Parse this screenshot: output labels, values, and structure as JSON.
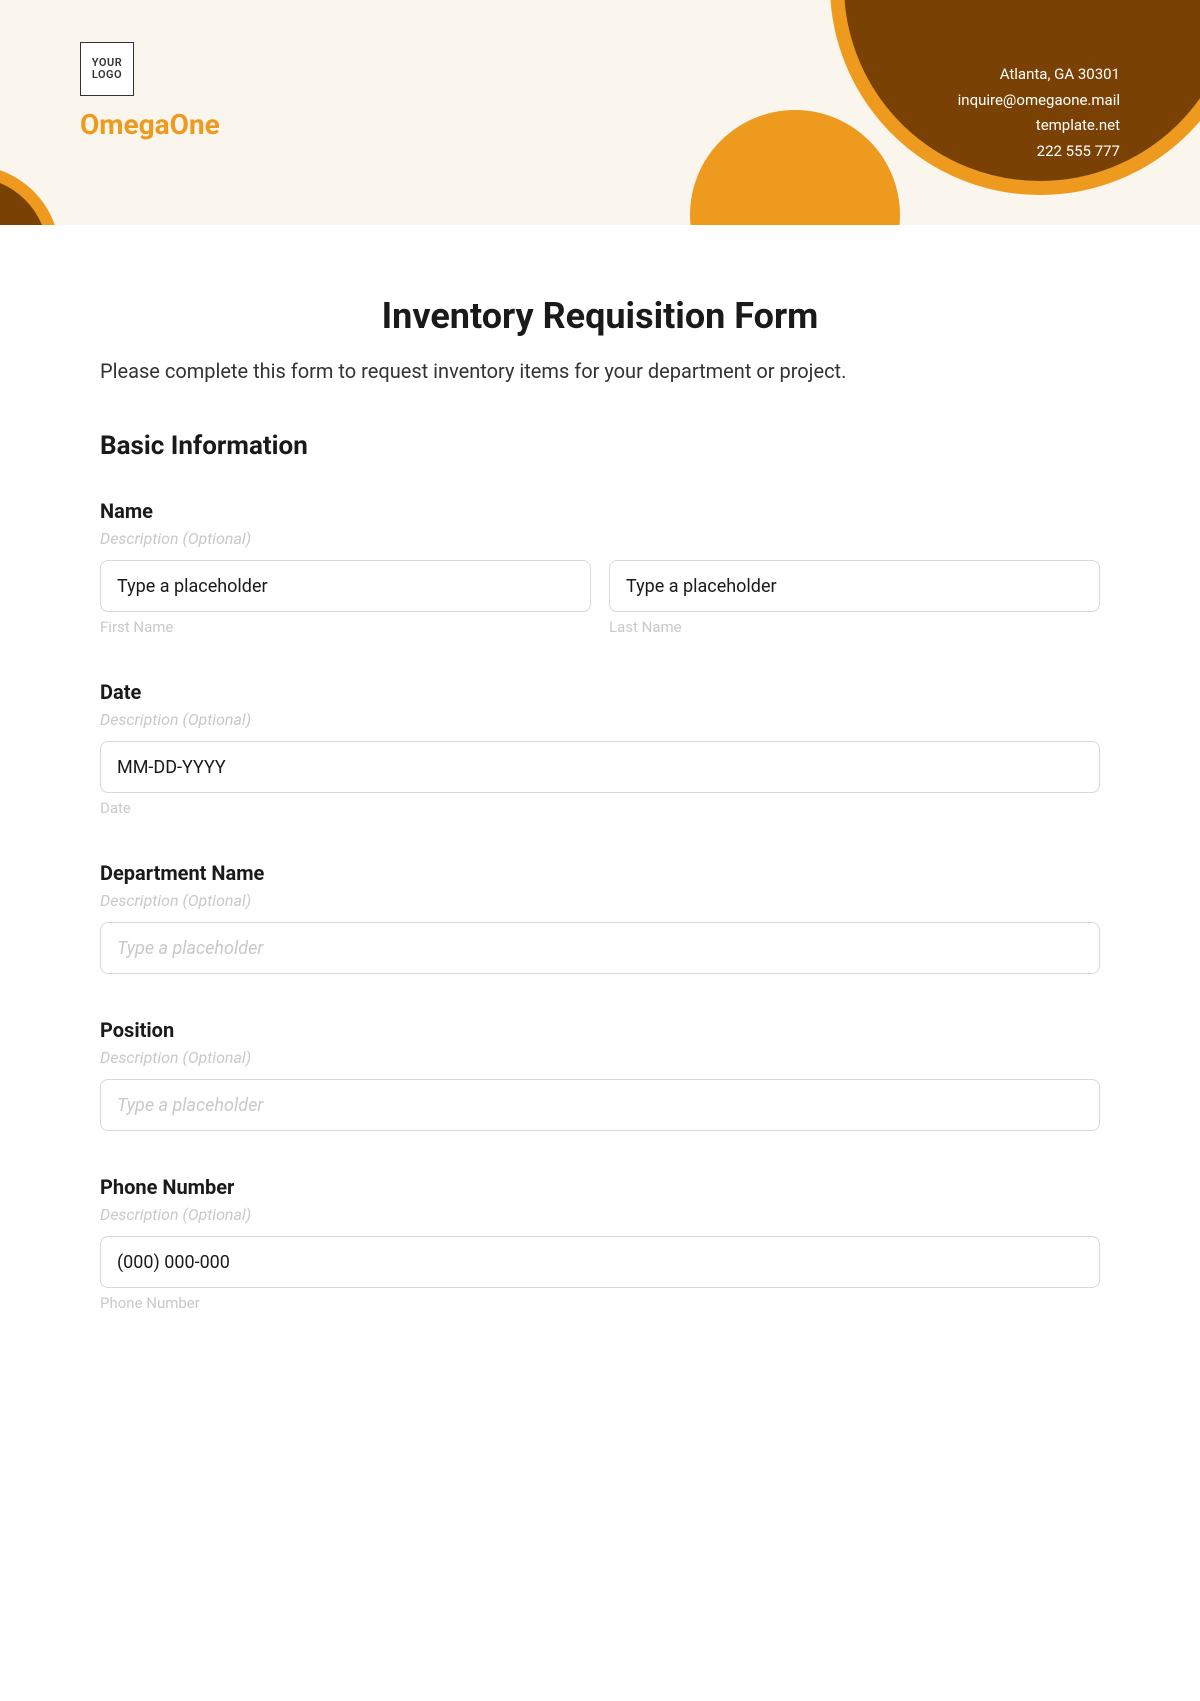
{
  "header": {
    "logo_text": "YOUR\nLOGO",
    "brand": "OmegaOne",
    "contact": {
      "address": "Atlanta, GA 30301",
      "email": "inquire@omegaone.mail",
      "website": "template.net",
      "phone": "222 555 777"
    }
  },
  "form": {
    "title": "Inventory Requisition Form",
    "subtitle": "Please complete this form to request inventory items for your department or project.",
    "section_heading": "Basic Information",
    "fields": {
      "name": {
        "label": "Name",
        "desc": "Description (Optional)",
        "first_value": "Type a placeholder",
        "first_sub": "First Name",
        "last_value": "Type a placeholder",
        "last_sub": "Last Name"
      },
      "date": {
        "label": "Date",
        "desc": "Description (Optional)",
        "value": "MM-DD-YYYY",
        "sub": "Date"
      },
      "department": {
        "label": "Department Name",
        "desc": "Description (Optional)",
        "placeholder": "Type a placeholder"
      },
      "position": {
        "label": "Position",
        "desc": "Description (Optional)",
        "placeholder": "Type a placeholder"
      },
      "phone": {
        "label": "Phone Number",
        "desc": "Description (Optional)",
        "value": "(000) 000-000",
        "sub": "Phone Number"
      }
    }
  }
}
